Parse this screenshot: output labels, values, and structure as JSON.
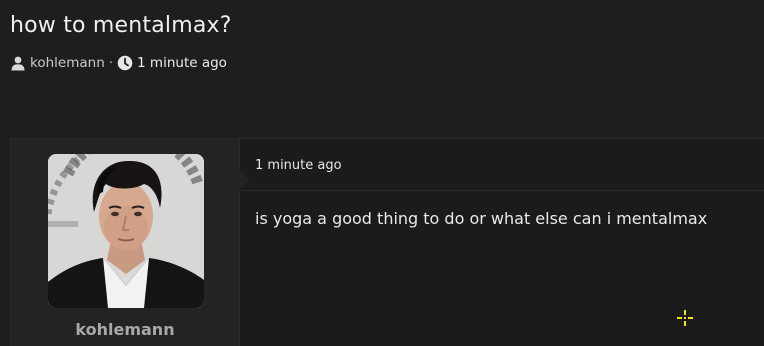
{
  "thread": {
    "title": "how to mentalmax?",
    "author": "kohlemann",
    "separator": "·",
    "time": "1 minute ago"
  },
  "post": {
    "username": "kohlemann",
    "timestamp": "1 minute ago",
    "content": "is yoga a good thing to do or what else can i mentalmax"
  },
  "icons": {
    "author": "user-icon",
    "time": "clock-icon",
    "cursor": "move-cursor-icon"
  },
  "colors": {
    "background": "#1e1e1f",
    "user_panel": "#232324",
    "cursor": "#f2e600"
  }
}
